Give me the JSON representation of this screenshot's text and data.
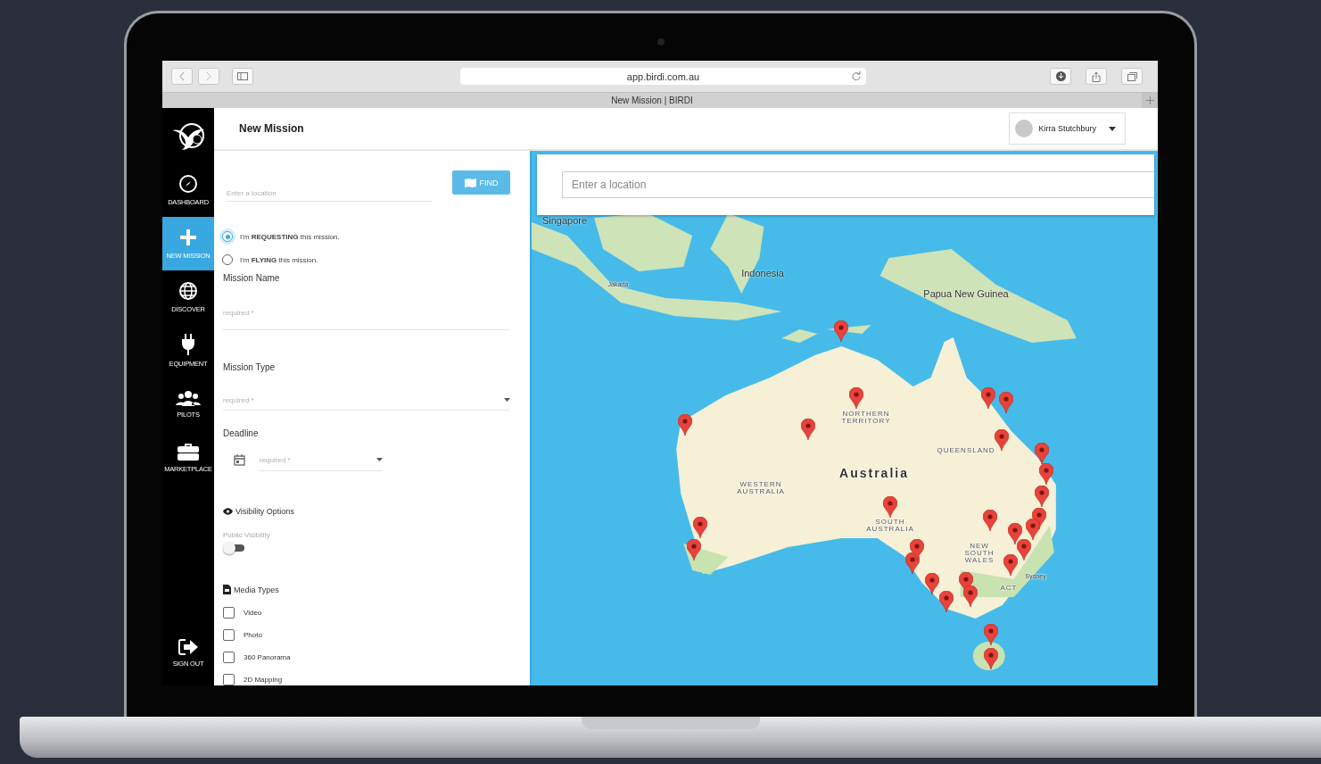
{
  "browser": {
    "url": "app.birdi.com.au",
    "tab_title": "New Mission | BIRDI"
  },
  "sidebar": {
    "items": [
      {
        "label": "DASHBOARD",
        "kind": "compass",
        "selected": false
      },
      {
        "label": "NEW MISSION",
        "kind": "plus",
        "selected": true
      },
      {
        "label": "DISCOVER",
        "kind": "globe",
        "selected": false
      },
      {
        "label": "EQUIPMENT",
        "kind": "plug",
        "selected": false
      },
      {
        "label": "PILOTS",
        "kind": "people",
        "selected": false
      },
      {
        "label": "MARKETPLACE",
        "kind": "briefcase",
        "selected": false
      }
    ],
    "sign_out": "SIGN OUT"
  },
  "header": {
    "title": "New Mission",
    "user": "Kirra Stutchbury"
  },
  "form": {
    "location": {
      "placeholder": "Enter a location"
    },
    "find_button": "FIND",
    "roles": [
      {
        "label": "I'm **REQUESTING** this mission.",
        "selected": true
      },
      {
        "label": "I'm **FLYING** this mission.",
        "selected": false
      }
    ],
    "mission_name": {
      "label": "Mission Name",
      "placeholder": "required *"
    },
    "mission_type": {
      "label": "Mission Type",
      "placeholder": "required *"
    },
    "deadline": {
      "label": "Deadline",
      "placeholder": "required *"
    },
    "visibility": {
      "heading": "Visibility Options",
      "toggle_label": "Public Visibility",
      "on": false
    },
    "media_types": {
      "heading": "Media Types",
      "options": [
        {
          "label": "Video",
          "checked": false
        },
        {
          "label": "Photo",
          "checked": false
        },
        {
          "label": "360 Panorama",
          "checked": false
        },
        {
          "label": "2D Mapping",
          "checked": false
        }
      ]
    }
  },
  "map": {
    "search": {
      "placeholder": "Enter a location"
    },
    "labels": [
      {
        "text": "Singapore",
        "kind": "place"
      },
      {
        "text": "Jakarta",
        "kind": "city"
      },
      {
        "text": "Indonesia",
        "kind": "place"
      },
      {
        "text": "Papua New Guinea",
        "kind": "place"
      },
      {
        "text": "NORTHERN TERRITORY",
        "kind": "region"
      },
      {
        "text": "QUEENSLAND",
        "kind": "region"
      },
      {
        "text": "WESTERN AUSTRALIA",
        "kind": "region"
      },
      {
        "text": "Australia",
        "kind": "country"
      },
      {
        "text": "SOUTH AUSTRALIA",
        "kind": "region"
      },
      {
        "text": "NEW SOUTH WALES",
        "kind": "region"
      },
      {
        "text": "ACT",
        "kind": "region"
      },
      {
        "text": "Sydney",
        "kind": "city"
      }
    ]
  }
}
